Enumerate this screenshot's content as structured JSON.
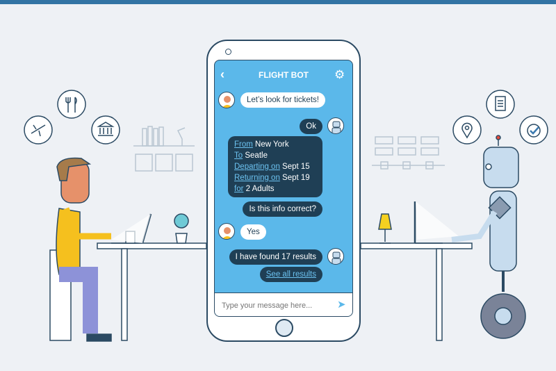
{
  "header": {
    "title": "FLIGHT BOT",
    "back_icon": "chevron-left-icon",
    "settings_icon": "gear-icon"
  },
  "messages": [
    {
      "sender": "user",
      "text": "Let’s look for tickets!"
    },
    {
      "sender": "bot",
      "text": "Ok"
    },
    {
      "sender": "bot",
      "summary": [
        {
          "label": "From",
          "value": " New York"
        },
        {
          "label": "To",
          "value": " Seatle"
        },
        {
          "label": "Departing on",
          "value": " Sept 15"
        },
        {
          "label": "Returning on",
          "value": " Sept 19"
        },
        {
          "label": "for",
          "value": " 2 Adults"
        }
      ]
    },
    {
      "sender": "bot",
      "text": "Is this info correct?"
    },
    {
      "sender": "user",
      "text": "Yes"
    },
    {
      "sender": "bot",
      "text": "I have found 17 results"
    },
    {
      "sender": "bot",
      "link": "See all results"
    }
  ],
  "composer": {
    "placeholder": "Type your message here...",
    "send_icon": "send-icon"
  },
  "colors": {
    "screen": "#5bb8ea",
    "bot_bubble": "#1f3f55",
    "user_bubble": "#ffffff",
    "outline": "#2b4a63",
    "top_bar": "#3274a4"
  }
}
